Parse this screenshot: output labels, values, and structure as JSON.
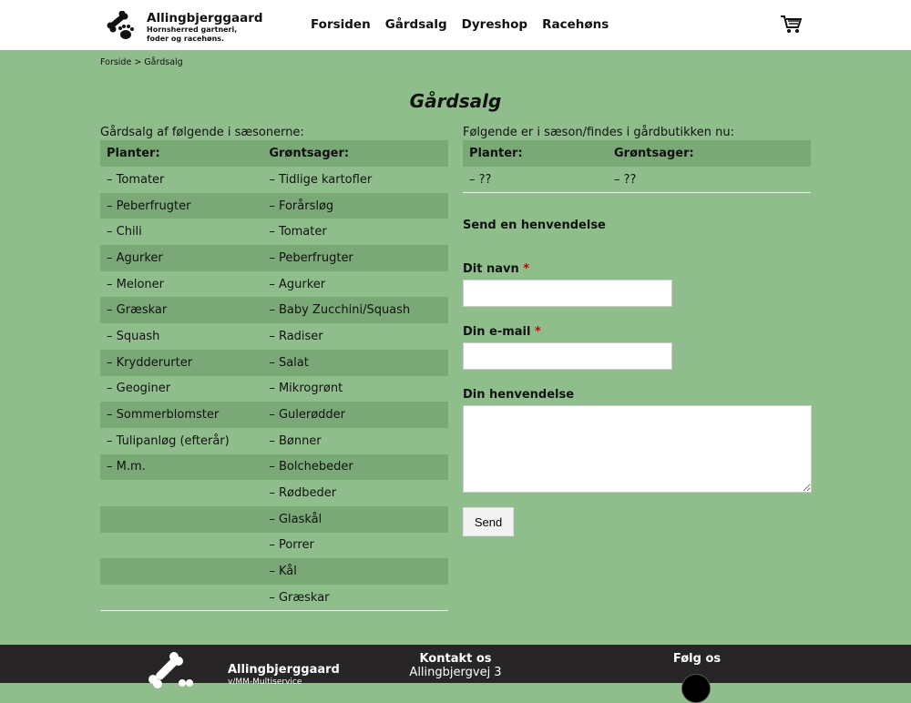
{
  "header": {
    "brand": "Allingbjerggaard",
    "tagline1": "Hornsherred gartneri,",
    "tagline2": "foder og racehøns.",
    "nav": [
      "Forsiden",
      "Gårdsalg",
      "Dyreshop",
      "Racehøns"
    ]
  },
  "breadcrumb": "Forside > Gårdsalg",
  "title": "Gårdsalg",
  "left": {
    "caption": "Gårdsalg af følgende i sæsonerne:",
    "headers": [
      "Planter:",
      "Grøntsager:"
    ],
    "rows": [
      [
        "– Tomater",
        "– Tidlige kartofler"
      ],
      [
        "– Peberfrugter",
        "– Forårsløg"
      ],
      [
        "– Chili",
        "– Tomater"
      ],
      [
        "– Agurker",
        "– Peberfrugter"
      ],
      [
        "– Meloner",
        "– Agurker"
      ],
      [
        "– Græskar",
        "– Baby Zucchini/Squash"
      ],
      [
        "– Squash",
        "– Radiser"
      ],
      [
        "– Krydderurter",
        "– Salat"
      ],
      [
        "– Geoginer",
        "– Mikrogrønt"
      ],
      [
        "– Sommerblomster",
        "– Gulerødder"
      ],
      [
        "– Tulipanløg (efterår)",
        "– Bønner"
      ],
      [
        "– M.m.",
        "– Bolchebeder"
      ],
      [
        "",
        "– Rødbeder"
      ],
      [
        "",
        "– Glaskål"
      ],
      [
        "",
        "– Porrer"
      ],
      [
        "",
        "– Kål"
      ],
      [
        "",
        "– Græskar"
      ]
    ]
  },
  "right": {
    "caption": "Følgende er i sæson/findes i gårdbutikken nu:",
    "headers": [
      "Planter:",
      "Grøntsager:"
    ],
    "rows": [
      [
        "– ??",
        "– ??"
      ]
    ]
  },
  "form": {
    "heading": "Send en henvendelse",
    "name_label": "Dit navn",
    "email_label": "Din e-mail",
    "required": "*",
    "message_label": "Din henvendelse",
    "submit": "Send"
  },
  "footer": {
    "brand": "Allingbjerggaard",
    "sub": "v/MM-Multiservice",
    "contact_title": "Kontakt os",
    "address": "Allingbjergvej 3",
    "follow": "Følg os"
  }
}
